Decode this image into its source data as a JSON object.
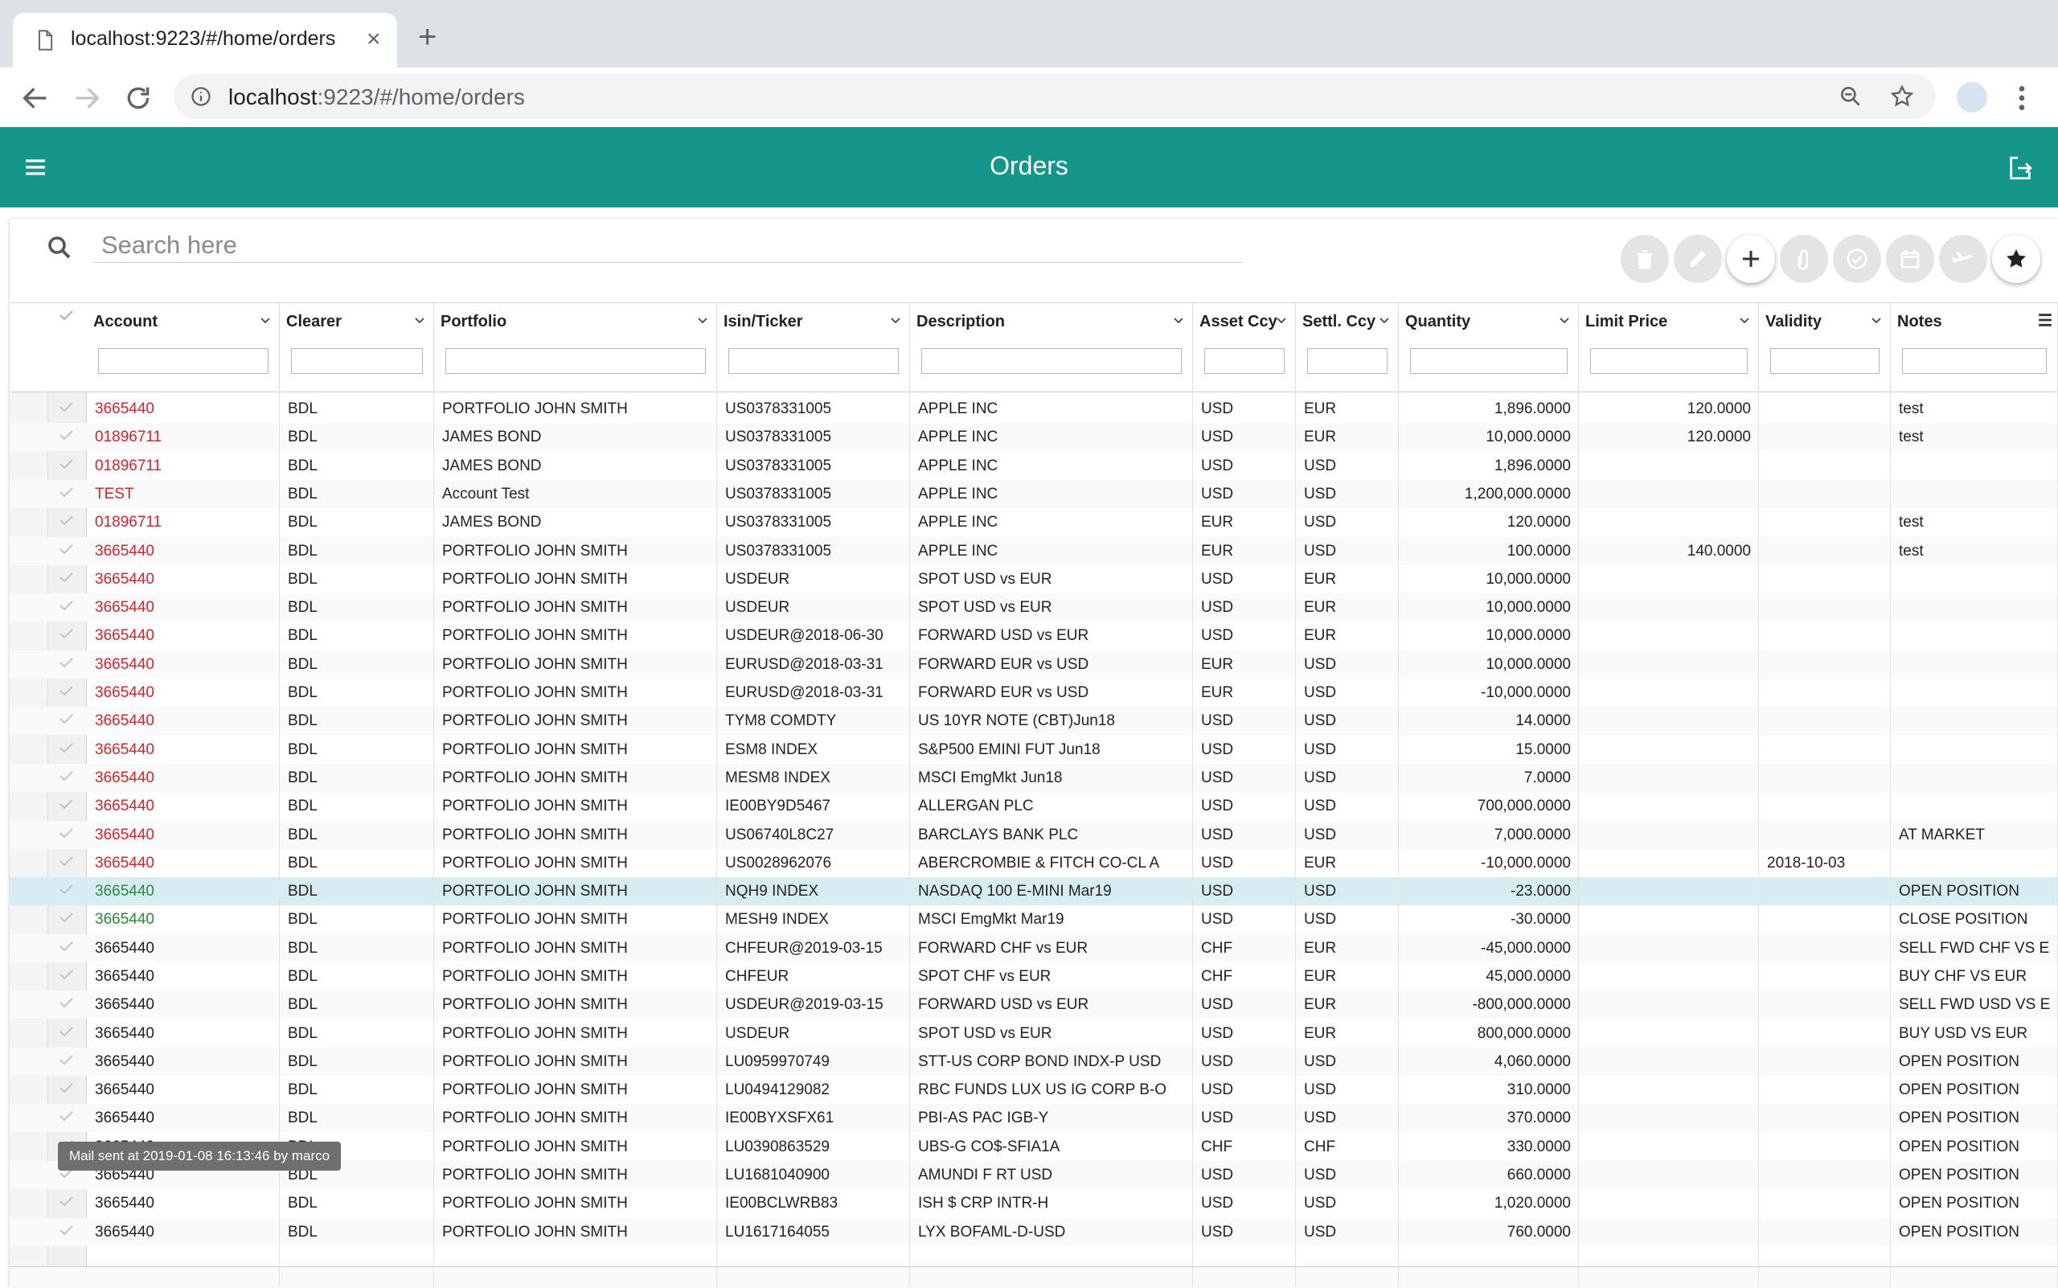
{
  "browser": {
    "tab_title": "localhost:9223/#/home/orders",
    "url_host": "localhost",
    "url_rest": ":9223/#/home/orders"
  },
  "app": {
    "title": "Orders"
  },
  "search": {
    "placeholder": "Search here"
  },
  "columns": [
    "Account",
    "Clearer",
    "Portfolio",
    "Isin/Ticker",
    "Description",
    "Asset Ccy",
    "Settl. Ccy",
    "Quantity",
    "Limit Price",
    "Validity",
    "Notes"
  ],
  "rows": [
    [
      "3665440",
      "BDL",
      "PORTFOLIO JOHN SMITH",
      "US0378331005",
      "APPLE INC",
      "USD",
      "EUR",
      "1,896.0000",
      "120.0000",
      "",
      "test"
    ],
    [
      "01896711",
      "BDL",
      "JAMES BOND",
      "US0378331005",
      "APPLE INC",
      "USD",
      "EUR",
      "10,000.0000",
      "120.0000",
      "",
      "test"
    ],
    [
      "01896711",
      "BDL",
      "JAMES BOND",
      "US0378331005",
      "APPLE INC",
      "USD",
      "USD",
      "1,896.0000",
      "",
      "",
      ""
    ],
    [
      "TEST",
      "BDL",
      "Account Test",
      "US0378331005",
      "APPLE INC",
      "USD",
      "USD",
      "1,200,000.0000",
      "",
      "",
      ""
    ],
    [
      "01896711",
      "BDL",
      "JAMES BOND",
      "US0378331005",
      "APPLE INC",
      "EUR",
      "USD",
      "120.0000",
      "",
      "",
      "test"
    ],
    [
      "3665440",
      "BDL",
      "PORTFOLIO JOHN SMITH",
      "US0378331005",
      "APPLE INC",
      "EUR",
      "USD",
      "100.0000",
      "140.0000",
      "",
      "test"
    ],
    [
      "3665440",
      "BDL",
      "PORTFOLIO JOHN SMITH",
      "USDEUR",
      "SPOT USD vs EUR",
      "USD",
      "EUR",
      "10,000.0000",
      "",
      "",
      ""
    ],
    [
      "3665440",
      "BDL",
      "PORTFOLIO JOHN SMITH",
      "USDEUR",
      "SPOT USD vs EUR",
      "USD",
      "EUR",
      "10,000.0000",
      "",
      "",
      ""
    ],
    [
      "3665440",
      "BDL",
      "PORTFOLIO JOHN SMITH",
      "USDEUR@2018-06-30",
      "FORWARD USD vs EUR",
      "USD",
      "EUR",
      "10,000.0000",
      "",
      "",
      ""
    ],
    [
      "3665440",
      "BDL",
      "PORTFOLIO JOHN SMITH",
      "EURUSD@2018-03-31",
      "FORWARD EUR vs USD",
      "EUR",
      "USD",
      "10,000.0000",
      "",
      "",
      ""
    ],
    [
      "3665440",
      "BDL",
      "PORTFOLIO JOHN SMITH",
      "EURUSD@2018-03-31",
      "FORWARD EUR vs USD",
      "EUR",
      "USD",
      "-10,000.0000",
      "",
      "",
      ""
    ],
    [
      "3665440",
      "BDL",
      "PORTFOLIO JOHN SMITH",
      "TYM8 COMDTY",
      "US 10YR NOTE (CBT)Jun18",
      "USD",
      "USD",
      "14.0000",
      "",
      "",
      ""
    ],
    [
      "3665440",
      "BDL",
      "PORTFOLIO JOHN SMITH",
      "ESM8 INDEX",
      "S&P500 EMINI FUT Jun18",
      "USD",
      "USD",
      "15.0000",
      "",
      "",
      ""
    ],
    [
      "3665440",
      "BDL",
      "PORTFOLIO JOHN SMITH",
      "MESM8 INDEX",
      "MSCI EmgMkt Jun18",
      "USD",
      "USD",
      "7.0000",
      "",
      "",
      ""
    ],
    [
      "3665440",
      "BDL",
      "PORTFOLIO JOHN SMITH",
      "IE00BY9D5467",
      "ALLERGAN PLC",
      "USD",
      "USD",
      "700,000.0000",
      "",
      "",
      ""
    ],
    [
      "3665440",
      "BDL",
      "PORTFOLIO JOHN SMITH",
      "US06740L8C27",
      "BARCLAYS BANK PLC",
      "USD",
      "USD",
      "7,000.0000",
      "",
      "",
      "AT MARKET"
    ],
    [
      "3665440",
      "BDL",
      "PORTFOLIO JOHN SMITH",
      "US0028962076",
      "ABERCROMBIE & FITCH CO-CL A",
      "USD",
      "EUR",
      "-10,000.0000",
      "",
      "2018-10-03",
      ""
    ],
    [
      "3665440",
      "BDL",
      "PORTFOLIO JOHN SMITH",
      "NQH9 INDEX",
      "NASDAQ 100 E-MINI Mar19",
      "USD",
      "USD",
      "-23.0000",
      "",
      "",
      "OPEN POSITION"
    ],
    [
      "3665440",
      "BDL",
      "PORTFOLIO JOHN SMITH",
      "MESH9 INDEX",
      "MSCI EmgMkt Mar19",
      "USD",
      "USD",
      "-30.0000",
      "",
      "",
      "CLOSE POSITION"
    ],
    [
      "3665440",
      "BDL",
      "PORTFOLIO JOHN SMITH",
      "CHFEUR@2019-03-15",
      "FORWARD CHF vs EUR",
      "CHF",
      "EUR",
      "-45,000.0000",
      "",
      "",
      "SELL FWD CHF VS EUR"
    ],
    [
      "3665440",
      "BDL",
      "PORTFOLIO JOHN SMITH",
      "CHFEUR",
      "SPOT CHF vs EUR",
      "CHF",
      "EUR",
      "45,000.0000",
      "",
      "",
      "BUY CHF VS EUR"
    ],
    [
      "3665440",
      "BDL",
      "PORTFOLIO JOHN SMITH",
      "USDEUR@2019-03-15",
      "FORWARD USD vs EUR",
      "USD",
      "EUR",
      "-800,000.0000",
      "",
      "",
      "SELL FWD USD VS EUR"
    ],
    [
      "3665440",
      "BDL",
      "PORTFOLIO JOHN SMITH",
      "USDEUR",
      "SPOT USD vs EUR",
      "USD",
      "EUR",
      "800,000.0000",
      "",
      "",
      "BUY USD VS EUR"
    ],
    [
      "3665440",
      "BDL",
      "PORTFOLIO JOHN SMITH",
      "LU0959970749",
      "STT-US CORP BOND INDX-P USD",
      "USD",
      "USD",
      "4,060.0000",
      "",
      "",
      "OPEN POSITION"
    ],
    [
      "3665440",
      "BDL",
      "PORTFOLIO JOHN SMITH",
      "LU0494129082",
      "RBC FUNDS LUX US IG CORP B-O",
      "USD",
      "USD",
      "310.0000",
      "",
      "",
      "OPEN POSITION"
    ],
    [
      "3665440",
      "BDL",
      "PORTFOLIO JOHN SMITH",
      "IE00BYXSFX61",
      "PBI-AS PAC IGB-Y",
      "USD",
      "USD",
      "370.0000",
      "",
      "",
      "OPEN POSITION"
    ],
    [
      "3665440",
      "BDL",
      "PORTFOLIO JOHN SMITH",
      "LU0390863529",
      "UBS-G CO$-SFIA1A",
      "CHF",
      "CHF",
      "330.0000",
      "",
      "",
      "OPEN POSITION"
    ],
    [
      "3665440",
      "BDL",
      "PORTFOLIO JOHN SMITH",
      "LU1681040900",
      "AMUNDI F RT USD",
      "USD",
      "USD",
      "660.0000",
      "",
      "",
      "OPEN POSITION"
    ],
    [
      "3665440",
      "BDL",
      "PORTFOLIO JOHN SMITH",
      "IE00BCLWRB83",
      "ISH $ CRP INTR-H",
      "USD",
      "USD",
      "1,020.0000",
      "",
      "",
      "OPEN POSITION"
    ],
    [
      "3665440",
      "BDL",
      "PORTFOLIO JOHN SMITH",
      "LU1617164055",
      "LYX BOFAML-D-USD",
      "USD",
      "USD",
      "760.0000",
      "",
      "",
      "OPEN POSITION"
    ]
  ],
  "row_status": [
    "red",
    "red",
    "red",
    "red",
    "red",
    "red",
    "red",
    "red",
    "red",
    "red",
    "red",
    "red",
    "red",
    "red",
    "red",
    "red",
    "red",
    "green",
    "green",
    "black",
    "black",
    "black",
    "black",
    "black",
    "black",
    "black",
    "black",
    "black",
    "black",
    "black"
  ],
  "selected_row": 17,
  "tooltip": "Mail sent at 2019-01-08 16:13:46 by marco",
  "colors": {
    "appbar": "#16968a",
    "account_red": "#d0252f",
    "account_green": "#2a8a3a",
    "selected_row": "#d7edf3"
  },
  "icons": [
    "page-icon",
    "close-icon",
    "plus-icon",
    "back-arrow-icon",
    "forward-arrow-icon",
    "reload-icon",
    "info-icon",
    "zoom-icon",
    "star-icon",
    "profile-icon",
    "kebab-menu-icon",
    "hamburger-menu-icon",
    "logout-icon",
    "search-icon",
    "trash-icon",
    "pencil-icon",
    "attachment-icon",
    "check-circle-icon",
    "calendar-icon",
    "plane-icon",
    "columns-menu-icon"
  ]
}
